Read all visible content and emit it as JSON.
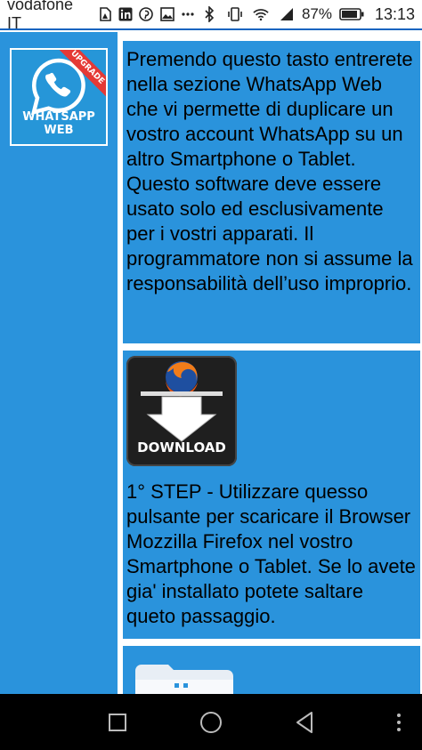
{
  "status_bar": {
    "carrier": "vodafone IT",
    "battery": "87%",
    "time": "13:13",
    "icons": [
      "sim-icon",
      "linkedin-icon",
      "pinterest-icon",
      "gallery-icon",
      "dots-icon",
      "bluetooth-icon",
      "vibrate-icon",
      "wifi-icon",
      "signal-icon",
      "battery-icon"
    ]
  },
  "sidebar": {
    "logo_label": "WHATSAPP WEB",
    "ribbon": "UPGRADE"
  },
  "sections": [
    {
      "text": "Premendo questo tasto entrerete nella sezione WhatsApp Web che vi permette di duplicare un vostro account WhatsApp su un altro Smartphone o Tablet. Questo software deve essere usato solo ed esclusivamente per i vostri apparati. Il programmatore non si assume la responsabilità dell’uso improprio."
    },
    {
      "button_label": "DOWNLOAD",
      "text": "1° STEP - Utilizzare quesso pulsante per scaricare il Browser Mozzilla Firefox nel vostro Smartphone o Tablet. Se lo avete gia' installato potete saltare queto passaggio."
    }
  ],
  "colors": {
    "panel": "#2a93dc",
    "background": "#ffffff",
    "navbar": "#000000"
  },
  "nav": {
    "icons": [
      "recents-icon",
      "home-icon",
      "back-icon",
      "menu-icon"
    ]
  }
}
